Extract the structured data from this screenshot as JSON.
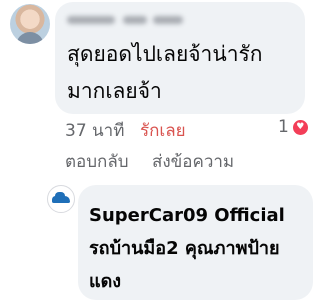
{
  "comment": {
    "text": "สุดยอดไปเลยจ้าน่ารักมากเลยจ้า",
    "time": "37 นาที",
    "like_label": "รักเลย",
    "reaction_count": "1",
    "reaction_icon": "heart-icon",
    "reply_label": "ตอบกลับ",
    "message_label": "ส่งข้อความ"
  },
  "reply": {
    "text": "SuperCar09 Official รถบ้านมือ2 คุณภาพป้ายแดง"
  },
  "colors": {
    "bubble": "#eff2f5",
    "like_red": "#d9534f",
    "heart": "#f33e58",
    "meta_gray": "#65676b"
  }
}
